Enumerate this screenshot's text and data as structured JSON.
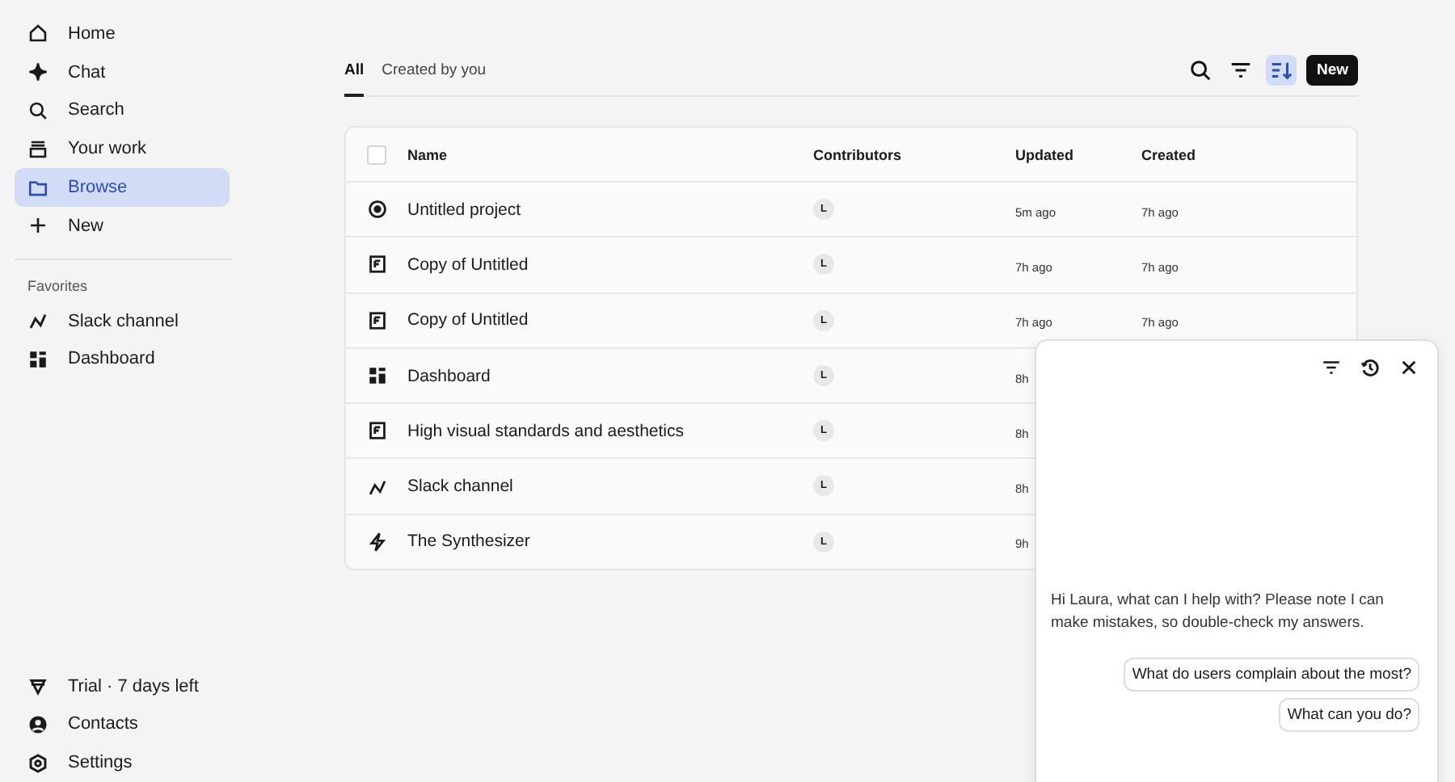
{
  "sidebar": {
    "items": [
      {
        "kind": "home",
        "label": "Home",
        "selected": false
      },
      {
        "kind": "chat",
        "label": "Chat",
        "selected": false
      },
      {
        "kind": "search",
        "label": "Search",
        "selected": false
      },
      {
        "kind": "work",
        "label": "Your work",
        "selected": false
      },
      {
        "kind": "folder",
        "label": "Browse",
        "selected": true
      },
      {
        "kind": "plus",
        "label": "New",
        "selected": false
      }
    ],
    "favorites_heading": "Favorites",
    "favorites": [
      {
        "kind": "slack",
        "label": "Slack channel"
      },
      {
        "kind": "dashboard",
        "label": "Dashboard"
      }
    ],
    "bottom": [
      {
        "kind": "gem",
        "label": "Trial · 7 days left"
      },
      {
        "kind": "person",
        "label": "Contacts"
      },
      {
        "kind": "settings",
        "label": "Settings"
      }
    ]
  },
  "tabs": [
    {
      "label": "All",
      "selected": true
    },
    {
      "label": "Created by you",
      "selected": false
    }
  ],
  "toolbar": {
    "buttons": [
      {
        "kind": "search",
        "on": false
      },
      {
        "kind": "filter",
        "on": false
      },
      {
        "kind": "sort",
        "on": true
      }
    ],
    "new_button": "New"
  },
  "table": {
    "select_all": {
      "checked": false
    },
    "columns": [
      "Name",
      "Contributors",
      "Updated",
      "Created"
    ],
    "rows": [
      {
        "kind": "project",
        "name": "Untitled project",
        "contributor": "L",
        "updated": "5m ago",
        "created": "7h ago"
      },
      {
        "kind": "doc",
        "name": "Copy of Untitled",
        "contributor": "L",
        "updated": "7h ago",
        "created": "7h ago"
      },
      {
        "kind": "doc",
        "name": "Copy of Untitled",
        "contributor": "L",
        "updated": "7h ago",
        "created": "7h ago"
      },
      {
        "kind": "dashboard",
        "name": "Dashboard",
        "contributor": "L",
        "updated": "8h"
      },
      {
        "kind": "doc",
        "name": "High visual standards and aesthetics",
        "contributor": "L",
        "updated": "8h"
      },
      {
        "kind": "slack",
        "name": "Slack channel",
        "contributor": "L",
        "updated": "8h"
      },
      {
        "kind": "synth",
        "name": "The Synthesizer",
        "contributor": "L",
        "updated": "9h"
      }
    ]
  },
  "chat_panel": {
    "message": "Hi Laura, what can I help with? Please note I can make mistakes, so double-check my answers.",
    "suggestions": [
      "What do users complain about the most?",
      "What can you do?"
    ]
  }
}
